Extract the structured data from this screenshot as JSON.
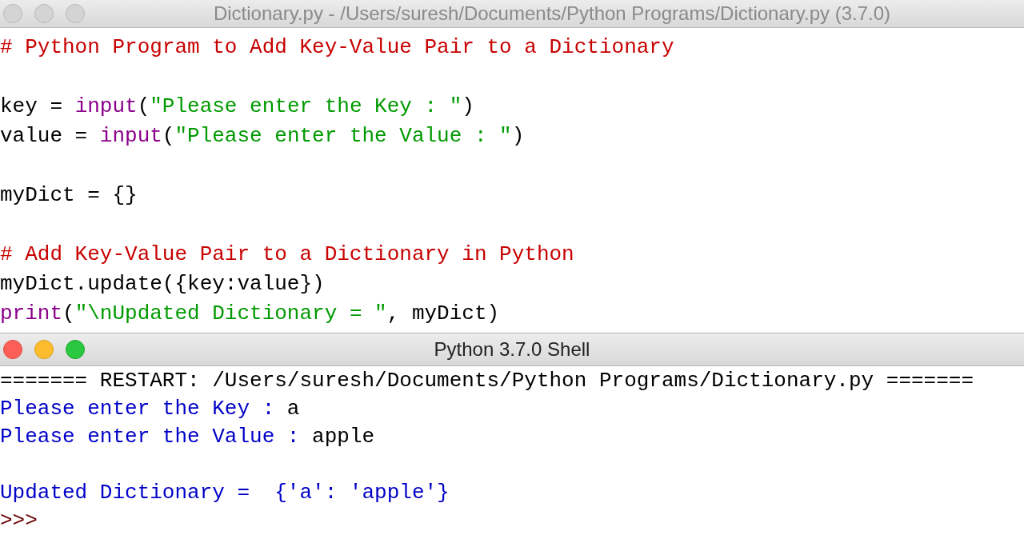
{
  "windows": [
    {
      "kind": "editor",
      "title": "Dictionary.py - /Users/suresh/Documents/Python Programs/Dictionary.py (3.7.0)",
      "active": false,
      "lines": [
        {
          "tokens": [
            {
              "kind": "comment",
              "text": "# Python Program to Add Key-Value Pair to a Dictionary"
            }
          ]
        },
        {
          "kind": "blank"
        },
        {
          "tokens": [
            {
              "kind": "plain",
              "text": "key = "
            },
            {
              "kind": "builtin",
              "text": "input"
            },
            {
              "kind": "plain",
              "text": "("
            },
            {
              "kind": "string",
              "text": "\"Please enter the Key : \""
            },
            {
              "kind": "plain",
              "text": ")"
            }
          ]
        },
        {
          "tokens": [
            {
              "kind": "plain",
              "text": "value = "
            },
            {
              "kind": "builtin",
              "text": "input"
            },
            {
              "kind": "plain",
              "text": "("
            },
            {
              "kind": "string",
              "text": "\"Please enter the Value : \""
            },
            {
              "kind": "plain",
              "text": ")"
            }
          ]
        },
        {
          "kind": "blank"
        },
        {
          "tokens": [
            {
              "kind": "plain",
              "text": "myDict = {}"
            }
          ]
        },
        {
          "kind": "blank"
        },
        {
          "tokens": [
            {
              "kind": "comment",
              "text": "# Add Key-Value Pair to a Dictionary in Python"
            }
          ]
        },
        {
          "tokens": [
            {
              "kind": "plain",
              "text": "myDict.update({key:value})"
            }
          ]
        },
        {
          "tokens": [
            {
              "kind": "builtin",
              "text": "print"
            },
            {
              "kind": "plain",
              "text": "("
            },
            {
              "kind": "string",
              "text": "\"\\nUpdated Dictionary = \""
            },
            {
              "kind": "plain",
              "text": ", myDict)"
            }
          ]
        }
      ]
    },
    {
      "kind": "shell",
      "title": "Python 3.7.0 Shell",
      "active": true,
      "lines": [
        {
          "tokens": [
            {
              "kind": "plain",
              "text": "======= RESTART: /Users/suresh/Documents/Python Programs/Dictionary.py ======="
            }
          ]
        },
        {
          "tokens": [
            {
              "kind": "output",
              "text": "Please enter the Key : "
            },
            {
              "kind": "plain",
              "text": "a"
            }
          ]
        },
        {
          "tokens": [
            {
              "kind": "output",
              "text": "Please enter the Value : "
            },
            {
              "kind": "plain",
              "text": "apple"
            }
          ]
        },
        {
          "kind": "blank"
        },
        {
          "tokens": [
            {
              "kind": "output",
              "text": "Updated Dictionary =  {'a': 'apple'}"
            }
          ]
        },
        {
          "tokens": [
            {
              "kind": "prompt",
              "text": ">>>"
            }
          ]
        }
      ]
    }
  ]
}
